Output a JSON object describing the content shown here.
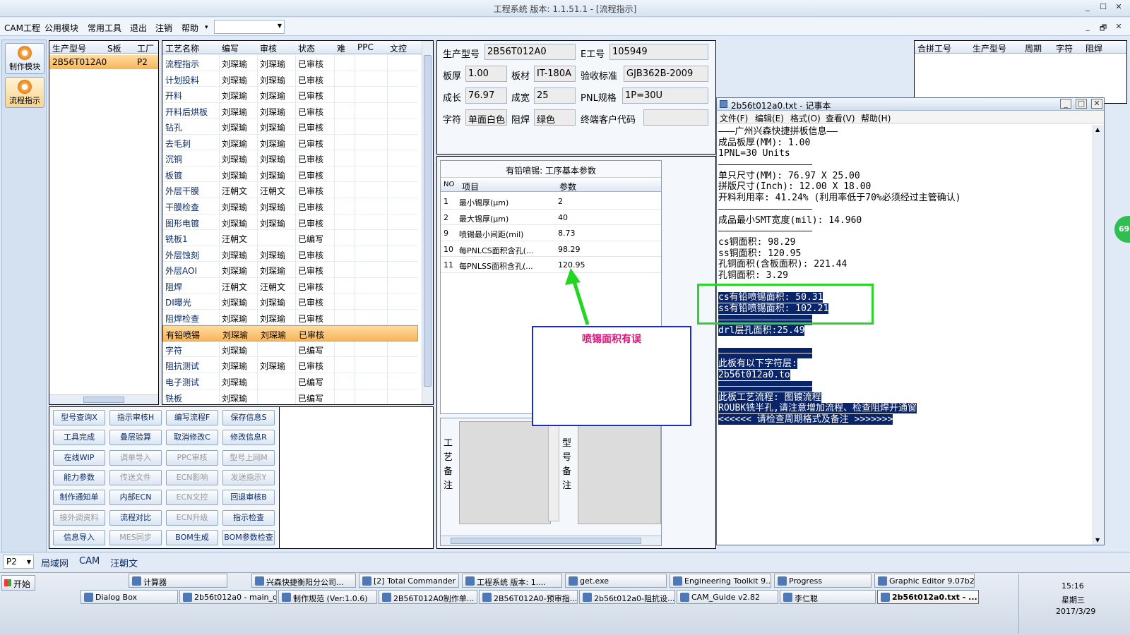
{
  "window": {
    "title": "工程系统  版本: 1.1.51.1 - [流程指示]",
    "min": "_",
    "max": "☐",
    "close": "✕",
    "inner_min": "_",
    "inner_max": "🗗",
    "inner_close": "✕"
  },
  "menubar": {
    "items": [
      "CAM工程",
      "公用模块",
      "常用工具",
      "退出",
      "注销",
      "帮助"
    ],
    "help_arrow": "▾",
    "combo_value": ""
  },
  "leftnav": [
    {
      "label": "制作模块",
      "icon": "module-icon"
    },
    {
      "label": "流程指示",
      "icon": "flow-icon"
    }
  ],
  "model_table": {
    "headers": [
      "生产型号",
      "S板",
      "工厂"
    ],
    "rows": [
      {
        "model": "2B56T012A0",
        "s": "",
        "factory": "P2"
      }
    ]
  },
  "process_table": {
    "headers": [
      "工艺名称",
      "编写",
      "审核",
      "状态",
      "难",
      "PPC",
      "文控"
    ],
    "rows": [
      [
        "流程指示",
        "刘琛瑜",
        "刘琛瑜",
        "已审核"
      ],
      [
        "计划投料",
        "刘琛瑜",
        "刘琛瑜",
        "已审核"
      ],
      [
        "开料",
        "刘琛瑜",
        "刘琛瑜",
        "已审核"
      ],
      [
        "开料后烘板",
        "刘琛瑜",
        "刘琛瑜",
        "已审核"
      ],
      [
        "钻孔",
        "刘琛瑜",
        "刘琛瑜",
        "已审核"
      ],
      [
        "去毛刺",
        "刘琛瑜",
        "刘琛瑜",
        "已审核"
      ],
      [
        "沉铜",
        "刘琛瑜",
        "刘琛瑜",
        "已审核"
      ],
      [
        "板镀",
        "刘琛瑜",
        "刘琛瑜",
        "已审核"
      ],
      [
        "外层干膜",
        "汪朝文",
        "汪朝文",
        "已审核"
      ],
      [
        "干膜检查",
        "刘琛瑜",
        "刘琛瑜",
        "已审核"
      ],
      [
        "图形电镀",
        "刘琛瑜",
        "刘琛瑜",
        "已审核"
      ],
      [
        "铣板1",
        "汪朝文",
        "",
        "已编写"
      ],
      [
        "外层蚀刻",
        "刘琛瑜",
        "刘琛瑜",
        "已审核"
      ],
      [
        "外层AOI",
        "刘琛瑜",
        "刘琛瑜",
        "已审核"
      ],
      [
        "阻焊",
        "汪朝文",
        "汪朝文",
        "已审核"
      ],
      [
        "DI曝光",
        "刘琛瑜",
        "刘琛瑜",
        "已审核"
      ],
      [
        "阻焊检查",
        "刘琛瑜",
        "刘琛瑜",
        "已审核"
      ],
      [
        "有铅喷锡",
        "刘琛瑜",
        "刘琛瑜",
        "已审核"
      ],
      [
        "字符",
        "刘琛瑜",
        "",
        "已编写"
      ],
      [
        "阻抗测试",
        "刘琛瑜",
        "刘琛瑜",
        "已审核"
      ],
      [
        "电子测试",
        "刘琛瑜",
        "",
        "已编写"
      ],
      [
        "铣板",
        "刘琛瑜",
        "",
        "已编写"
      ]
    ],
    "selected_index": 17
  },
  "buttons": [
    [
      "型号查询X",
      "指示审核H",
      "编写流程F",
      "保存信息S"
    ],
    [
      "工具完成",
      "叠层验算",
      "取消修改C",
      "修改信息R"
    ],
    [
      "在线WIP",
      "调单导入",
      "PPC审核",
      "型号上网M"
    ],
    [
      "能力参数",
      "传送文件",
      "ECN影响",
      "发送指示Y"
    ],
    [
      "制作通知单",
      "内部ECN",
      "ECN文控",
      "回退审核B"
    ],
    [
      "接外调资料",
      "流程对比",
      "ECN升级",
      "指示检查"
    ],
    [
      "信息导入",
      "MES同步",
      "BOM生成",
      "BOM参数检查"
    ]
  ],
  "disabled_buttons": [
    "调单导入",
    "PPC审核",
    "型号上网M",
    "传送文件",
    "ECN影响",
    "发送指示Y",
    "ECN文控",
    "接外调资料",
    "ECN升级",
    "MES同步"
  ],
  "info": {
    "model_label": "生产型号",
    "model": "2B56T012A0",
    "e_label": "E工号",
    "e_no": "105949",
    "thick_label": "板厚",
    "thick": "1.00",
    "mat_label": "板材",
    "mat": "IT-180A",
    "std_label": "验收标准",
    "std": "GJB362B-2009",
    "len_label": "成长",
    "len": "76.97",
    "wid_label": "成宽",
    "wid": "25",
    "pnl_label": "PNL规格",
    "pnl": "1P=30U",
    "char_label": "字符",
    "char": "单面白色",
    "mask_label": "阻焊",
    "mask": "绿色",
    "cust_label": "终端客户代码",
    "cust": ""
  },
  "params": {
    "title": "有铅喷锡: 工序基本参数",
    "headers": [
      "NO",
      "项目",
      "参数"
    ],
    "rows": [
      [
        "1",
        "最小锡厚(μm)",
        "2"
      ],
      [
        "2",
        "最大锡厚(μm)",
        "40"
      ],
      [
        "9",
        "喷锡最小间距(mil)",
        "8.73"
      ],
      [
        "10",
        "每PNLCS面积含孔(...",
        "98.29"
      ],
      [
        "11",
        "每PNLSS面积含孔(...",
        "120.95"
      ]
    ]
  },
  "notes": {
    "process": "工艺备注",
    "model": "型号备注"
  },
  "annotation": {
    "text": "喷锡面积有误",
    "color": "#e0107a",
    "box_color": "#1a2ccf",
    "arrow_color": "#22d622",
    "highlight_color": "#2bd62b"
  },
  "right_table": {
    "headers": [
      "合拼工号",
      "生产型号",
      "周期",
      "字符",
      "阻焊"
    ]
  },
  "notepad": {
    "title": "2b56t012a0.txt - 记事本",
    "menu": [
      "文件(F)",
      "编辑(E)",
      "格式(O)",
      "查看(V)",
      "帮助(H)"
    ],
    "lines": [
      "———广州兴森快捷拼板信息——",
      "成品板厚(MM): 1.00",
      "1PNL=30 Units",
      "—————————————————",
      "单只尺寸(MM): 76.97 X 25.00",
      "拼版尺寸(Inch): 12.00 X 18.00",
      "开料利用率: 41.24% (利用率低于70%必须经过主管确认)",
      "—————————————————",
      "成品最小SMT宽度(mil): 14.960",
      "—————————————————",
      "cs铜面积: 98.29",
      "ss铜面积: 120.95",
      "孔铜面积(含板面积): 221.44",
      "孔铜面积: 3.29",
      "",
      "cs有铅喷锡面积: 50.31",
      "ss有铅喷锡面积: 102.21",
      "—————————————————",
      "drl层孔面积:25.49",
      "",
      "—————————————————",
      "此板有以下字符层:",
      "2b56t012a0.to",
      "—————————————————",
      "此板工艺流程: 图镀流程",
      "ROUBK铣半孔,请注意增加流程、检查阻焊开通窗",
      "<<<<<< 请检查周期格式及备注 >>>>>>>"
    ],
    "highlight_from": 15
  },
  "side_badge": "69",
  "statusbar": {
    "combo": "P2",
    "items": [
      "局域网",
      "CAM",
      "汪朝文"
    ]
  },
  "taskbar": {
    "start": "开始",
    "row1": [
      "计算器",
      "兴森快捷衡阳分公司...",
      "[2] Total Commander ...",
      "工程系统  版本: 1....",
      "get.exe",
      "Engineering Toolkit 9....",
      "Progress",
      "Graphic Editor 9.07b2 ..."
    ],
    "row2": [
      "Dialog Box",
      "2b56t012a0 - main_qa",
      "制作规范 (Ver:1.0.6)",
      "2B56T012A0制作单...",
      "2B56T012A0-预审指...",
      "2b56t012a0-阻抗设...",
      "CAM_Guide v2.82",
      "李仁聪",
      "2b56t012a0.txt - ..."
    ],
    "active": "2b56t012a0.txt - ...",
    "time": "15:16",
    "weekday": "星期三",
    "date": "2017/3/29"
  }
}
